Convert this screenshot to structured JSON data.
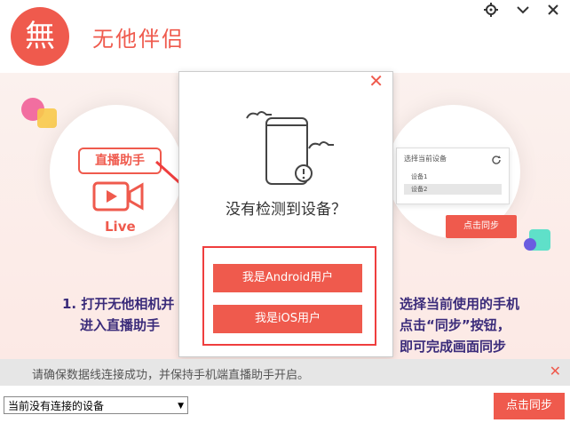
{
  "app": {
    "name": "无他伴侣",
    "logo_glyph": "無"
  },
  "window_controls": {
    "settings_icon": "gear-icon",
    "collapse_icon": "chevron-down-icon",
    "close_icon": "close-icon"
  },
  "guide": {
    "badge": "直播助手",
    "live_label": "Live",
    "step1": {
      "line1": "1. 打开无他相机并",
      "line2": "进入直播助手"
    },
    "step2": {
      "line1": "选择当前使用的手机",
      "line2": "点击“同步”按钮，",
      "line3": "即可完成画面同步"
    },
    "panel": {
      "title": "选择当前设备",
      "devices": [
        "设备1",
        "设备2"
      ]
    },
    "sync_preview_label": "点击同步"
  },
  "modal": {
    "question": "没有检测到设备？",
    "android_button": "我是Android用户",
    "ios_button": "我是iOS用户",
    "close_glyph": "✕"
  },
  "footer": {
    "message": "请确保数据线连接成功，并保持手机端直播助手开启。",
    "close_glyph": "✕"
  },
  "bottom": {
    "device_select": "当前没有连接的设备",
    "sync_button": "点击同步"
  },
  "colors": {
    "accent": "#ef5a4d",
    "highlight": "#ef3e3e",
    "text_purple": "#3a2b7a"
  }
}
